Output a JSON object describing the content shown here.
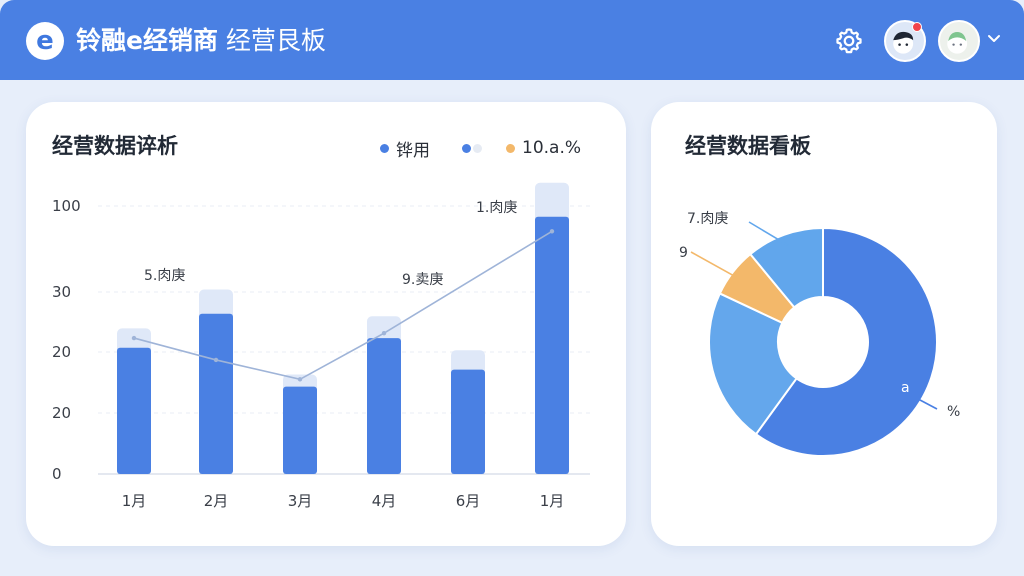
{
  "header": {
    "logo_letter": "e",
    "title_strong": "铃融e经销商",
    "title_rest": " 经营艮板",
    "brand_color": "#4a80e3"
  },
  "header_icons": {
    "settings": "gear-icon",
    "avatar_1": "avatar-icon",
    "avatar_2": "avatar-icon",
    "menu": "chevron-down-icon"
  },
  "left_panel": {
    "title": "经营数据谇析",
    "legend": [
      {
        "label": "铧用",
        "color": "#4a80e3"
      },
      {
        "label": "",
        "color": "#4a80e3"
      },
      {
        "label": "10.a.%",
        "color": "#f3b86a"
      }
    ]
  },
  "chart_data": [
    {
      "type": "bar",
      "categories": [
        "1月",
        "2月",
        "3月",
        "4月",
        "6月",
        "1月"
      ],
      "y_tick_labels": [
        "0",
        "20",
        "20",
        "30",
        "100"
      ],
      "series": [
        {
          "values": [
            8,
            10,
            5,
            9,
            8,
            14
          ],
          "color": "#dfe8f8"
        },
        {
          "values": [
            52,
            66,
            36,
            56,
            43,
            106
          ],
          "color": "#4a80e3"
        }
      ],
      "line": {
        "values": [
          56,
          47,
          39,
          58,
          null,
          100
        ],
        "color": "#9fb4d8"
      },
      "annotations": [
        {
          "category_index": 1,
          "text": "5.肉庚"
        },
        {
          "category_index": 3,
          "text": "9.卖庚"
        },
        {
          "category_index": 5,
          "text": "1.肉庚"
        }
      ]
    },
    {
      "type": "pie",
      "title": "经营数据看板",
      "slices": [
        {
          "value": 60,
          "color": "#4a80e3",
          "label": "%"
        },
        {
          "value": 22,
          "color": "#64a7ec",
          "label": ""
        },
        {
          "value": 7,
          "color": "#f3b86a",
          "label": "9"
        },
        {
          "value": 11,
          "color": "#61a6ec",
          "label": "7.肉庚"
        }
      ],
      "inner_label": "a"
    }
  ]
}
